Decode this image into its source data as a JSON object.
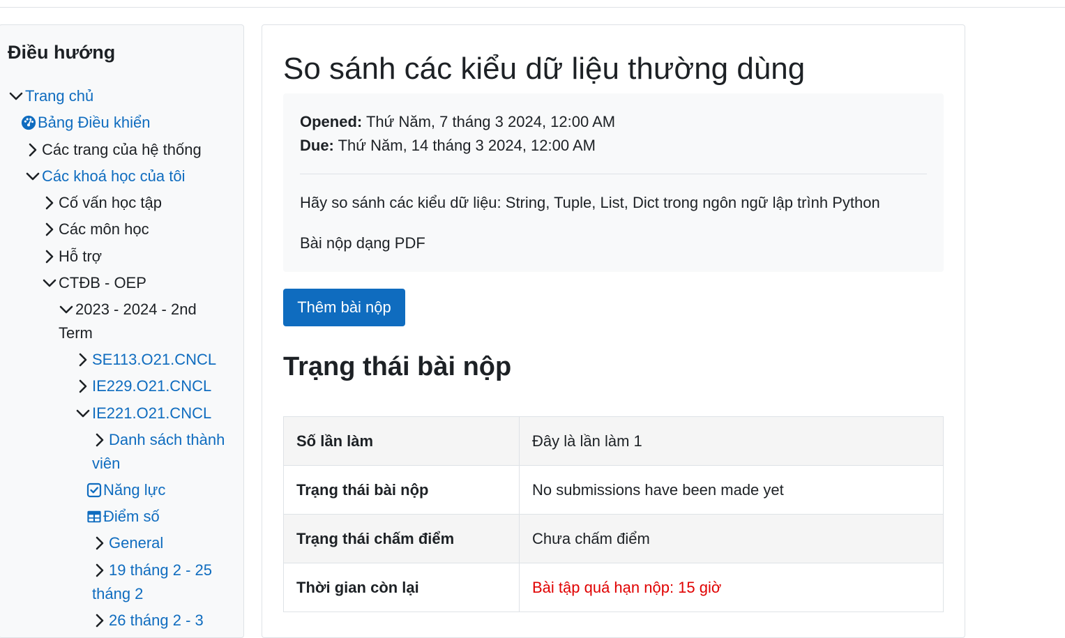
{
  "sidebar": {
    "heading": "Điều hướng",
    "items": [
      {
        "label": "Trang chủ",
        "icon": "chevron-down-icon",
        "link": true
      },
      {
        "label": "Bảng Điều khiển",
        "icon": "dashboard-icon",
        "link": true
      },
      {
        "label": "Các trang của hệ thống",
        "icon": "chevron-right-icon",
        "link": false
      },
      {
        "label": "Các khoá học của tôi",
        "icon": "chevron-down-icon",
        "link": true
      },
      {
        "label": "Cố vấn học tập",
        "icon": "chevron-right-icon",
        "link": false
      },
      {
        "label": "Các môn học",
        "icon": "chevron-right-icon",
        "link": false
      },
      {
        "label": "Hỗ trợ",
        "icon": "chevron-right-icon",
        "link": false
      },
      {
        "label": "CTĐB - OEP",
        "icon": "chevron-down-icon",
        "link": false
      },
      {
        "label": "2023 - 2024 - 2nd",
        "label2": "Term",
        "icon": "chevron-down-icon",
        "link": false
      },
      {
        "label": "SE113.O21.CNCL",
        "icon": "chevron-right-icon",
        "link": true
      },
      {
        "label": "IE229.O21.CNCL",
        "icon": "chevron-right-icon",
        "link": true
      },
      {
        "label": "IE221.O21.CNCL",
        "icon": "chevron-down-icon",
        "link": true
      },
      {
        "label": "Danh sách thành",
        "label2": "viên",
        "icon": "chevron-right-icon",
        "link": true
      },
      {
        "label": "Năng lực",
        "icon": "checkbox-icon",
        "link": true
      },
      {
        "label": "Điểm số",
        "icon": "grid-table-icon",
        "link": true
      },
      {
        "label": "General",
        "icon": "chevron-right-icon",
        "link": true
      },
      {
        "label": "19 tháng 2 - 25",
        "label2": "tháng 2",
        "icon": "chevron-right-icon",
        "link": true
      },
      {
        "label": "26 tháng 2 - 3",
        "icon": "chevron-right-icon",
        "link": true
      }
    ]
  },
  "main": {
    "title": "So sánh các kiểu dữ liệu thường dùng",
    "opened_label": "Opened:",
    "opened_value": "Thứ Năm, 7 tháng 3 2024, 12:00 AM",
    "due_label": "Due:",
    "due_value": "Thứ Năm, 14 tháng 3 2024, 12:00 AM",
    "description": "Hãy so sánh các kiểu dữ liệu: String, Tuple, List, Dict trong ngôn ngữ lập trình Python",
    "format_note": "Bài nộp dạng PDF",
    "add_submission_button": "Thêm bài nộp",
    "status_heading": "Trạng thái bài nộp",
    "status_rows": [
      {
        "label": "Số lần làm",
        "value": "Đây là lần làm 1"
      },
      {
        "label": "Trạng thái bài nộp",
        "value": "No submissions have been made yet"
      },
      {
        "label": "Trạng thái chấm điểm",
        "value": "Chưa chấm điểm"
      },
      {
        "label": "Thời gian còn lại",
        "value": "Bài tập quá hạn nộp: 15 giờ"
      }
    ]
  },
  "colors": {
    "link": "#0f6cbf",
    "primary_button": "#0f6cbf",
    "overdue": "#e00000"
  }
}
